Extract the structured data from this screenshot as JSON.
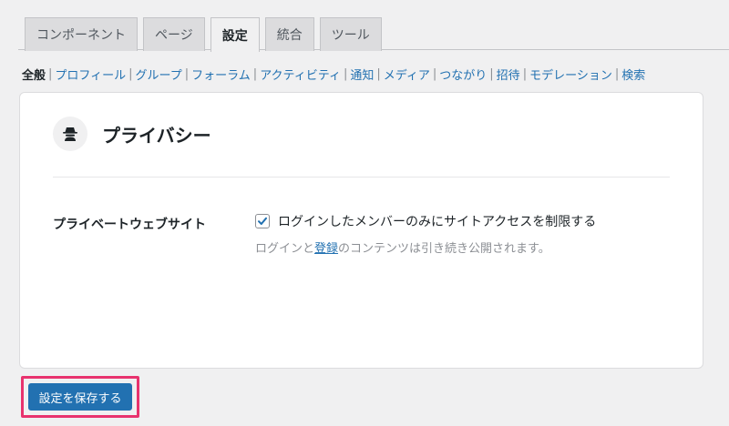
{
  "tabs": [
    {
      "label": "コンポーネント",
      "active": false
    },
    {
      "label": "ページ",
      "active": false
    },
    {
      "label": "設定",
      "active": true
    },
    {
      "label": "統合",
      "active": false
    },
    {
      "label": "ツール",
      "active": false
    }
  ],
  "subnav": {
    "separator": "|",
    "items": [
      "全般",
      "プロフィール",
      "グループ",
      "フォーラム",
      "アクティビティ",
      "通知",
      "メディア",
      "つながり",
      "招待",
      "モデレーション",
      "検索"
    ]
  },
  "card": {
    "title": "プライバシー",
    "icon": "spy-icon",
    "field": {
      "label": "プライベートウェブサイト",
      "checkbox_label": "ログインしたメンバーのみにサイトアクセスを制限する",
      "checked": true,
      "description_prefix": "ログインと",
      "description_link": "登録",
      "description_suffix": "のコンテンツは引き続き公開されます。"
    }
  },
  "save_button": {
    "label": "設定を保存する"
  },
  "colors": {
    "accent": "#2271b1",
    "highlight": "#e8336e",
    "background": "#f0f0f1"
  }
}
